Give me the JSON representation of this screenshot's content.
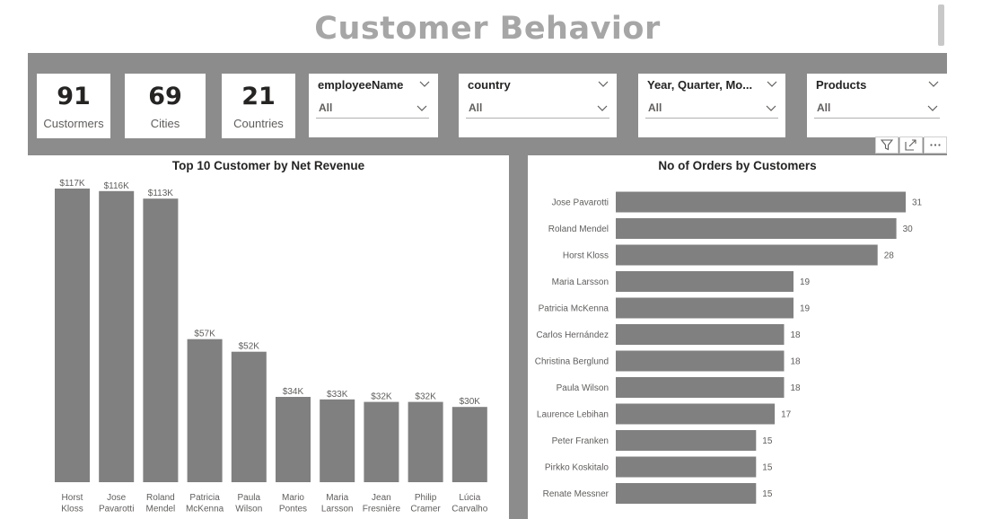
{
  "title": "Customer Behavior",
  "kpis": [
    {
      "value": "91",
      "label": "Custormers"
    },
    {
      "value": "69",
      "label": "Cities"
    },
    {
      "value": "21",
      "label": "Countries"
    }
  ],
  "slicers": [
    {
      "title": "employeeName",
      "value": "All"
    },
    {
      "title": "country",
      "value": "All"
    },
    {
      "title": "Year, Quarter, Mo...",
      "value": "All"
    },
    {
      "title": "Products",
      "value": "All"
    }
  ],
  "visual_header_icons": [
    "filter-icon",
    "focus-mode-icon",
    "more-options-icon"
  ],
  "colors": {
    "bar": "#808080",
    "background": "#8c8c8c",
    "title": "#a6a6a6"
  },
  "chart_data": [
    {
      "type": "bar",
      "title": "Top 10 Customer by Net Revenue",
      "categories": [
        "Horst\nKloss",
        "Jose\nPavarotti",
        "Roland\nMendel",
        "Patricia\nMcKenna",
        "Paula\nWilson",
        "Mario\nPontes",
        "Maria\nLarsson",
        "Jean\nFresnière",
        "Philip\nCramer",
        "Lúcia\nCarvalho"
      ],
      "values": [
        117,
        116,
        113,
        57,
        52,
        34,
        33,
        32,
        32,
        30
      ],
      "data_labels": [
        "$117K",
        "$116K",
        "$113K",
        "$57K",
        "$52K",
        "$34K",
        "$33K",
        "$32K",
        "$32K",
        "$30K"
      ],
      "ylim": [
        0,
        117
      ]
    },
    {
      "type": "bar",
      "orientation": "horizontal",
      "title": "No of Orders by Customers",
      "categories": [
        "Jose Pavarotti",
        "Roland Mendel",
        "Horst Kloss",
        "Maria Larsson",
        "Patricia McKenna",
        "Carlos Hernández",
        "Christina Berglund",
        "Paula Wilson",
        "Laurence Lebihan",
        "Peter Franken",
        "Pirkko Koskitalo",
        "Renate Messner"
      ],
      "values": [
        31,
        30,
        28,
        19,
        19,
        18,
        18,
        18,
        17,
        15,
        15,
        15
      ],
      "xlim": [
        0,
        31
      ]
    }
  ]
}
